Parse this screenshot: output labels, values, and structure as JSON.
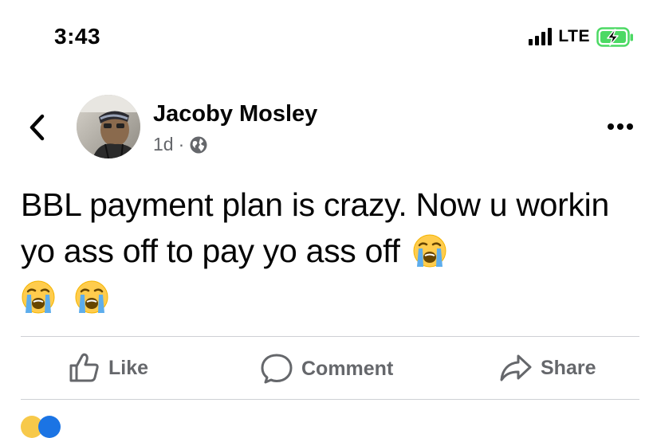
{
  "status_bar": {
    "time": "3:43",
    "network": "LTE",
    "signal_icon": "signal-bars-icon",
    "battery_icon": "battery-charging-icon",
    "battery_color": "#4cd964"
  },
  "header": {
    "back_icon": "chevron-left-icon",
    "author_name": "Jacoby Mosley",
    "timestamp": "1d",
    "separator": "·",
    "privacy_icon": "globe-icon",
    "more_icon": "more-horizontal-icon"
  },
  "post": {
    "text": "BBL payment plan is crazy. Now u workin yo ass off to pay yo ass off",
    "emoji_icon": "loudly-crying-face-icon",
    "emoji_count": 3
  },
  "actions": {
    "like_label": "Like",
    "comment_label": "Comment",
    "share_label": "Share",
    "like_icon": "thumbs-up-icon",
    "comment_icon": "comment-bubble-icon",
    "share_icon": "share-arrow-icon"
  },
  "colors": {
    "text_primary": "#050505",
    "text_secondary": "#65676b",
    "divider": "#ced0d4"
  }
}
